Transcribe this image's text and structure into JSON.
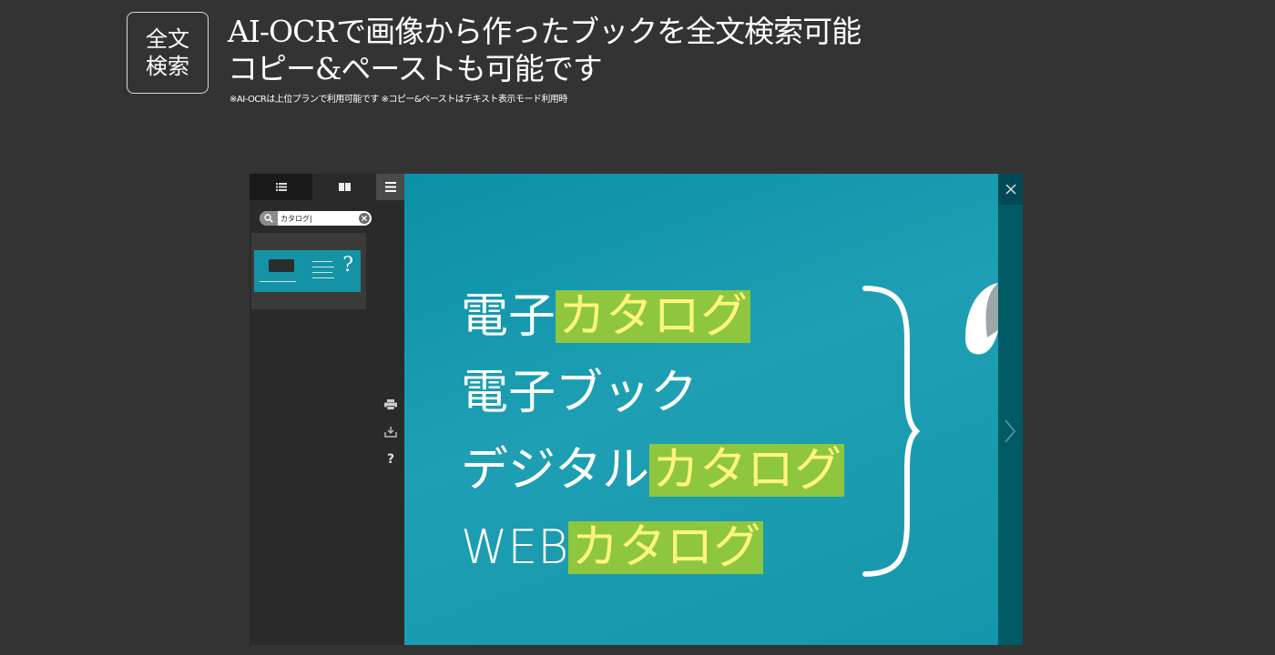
{
  "badge": {
    "line1": "全文",
    "line2": "検索"
  },
  "headline": {
    "line1": "AI-OCRで画像から作ったブックを全文検索可能",
    "line2": "コピー&ペーストも可能です"
  },
  "note": "※AI-OCRは上位プランで利用可能です ※コピー&ペーストはテキスト表示モード利用時",
  "viewer": {
    "tabs": [
      {
        "icon": "list-icon"
      },
      {
        "icon": "pages-icon"
      },
      {
        "icon": "menu-icon"
      }
    ],
    "search": {
      "value": "カタログ|",
      "placeholder": ""
    },
    "tools": [
      "print-icon",
      "download-icon",
      "help-icon"
    ],
    "help_label": "?",
    "thumbnail": {
      "mark": "?"
    },
    "page": {
      "rows": [
        {
          "plain": "電子",
          "highlight": "カタログ"
        },
        {
          "plain": "電子ブック",
          "highlight": ""
        },
        {
          "plain": "デジタル",
          "highlight": "カタログ"
        },
        {
          "plain": "WEB",
          "highlight": "カタログ"
        }
      ]
    },
    "colors": {
      "page_bg": "#1596ab",
      "highlight_bg": "#8ec63f",
      "highlight_text": "#fcf57c"
    }
  }
}
